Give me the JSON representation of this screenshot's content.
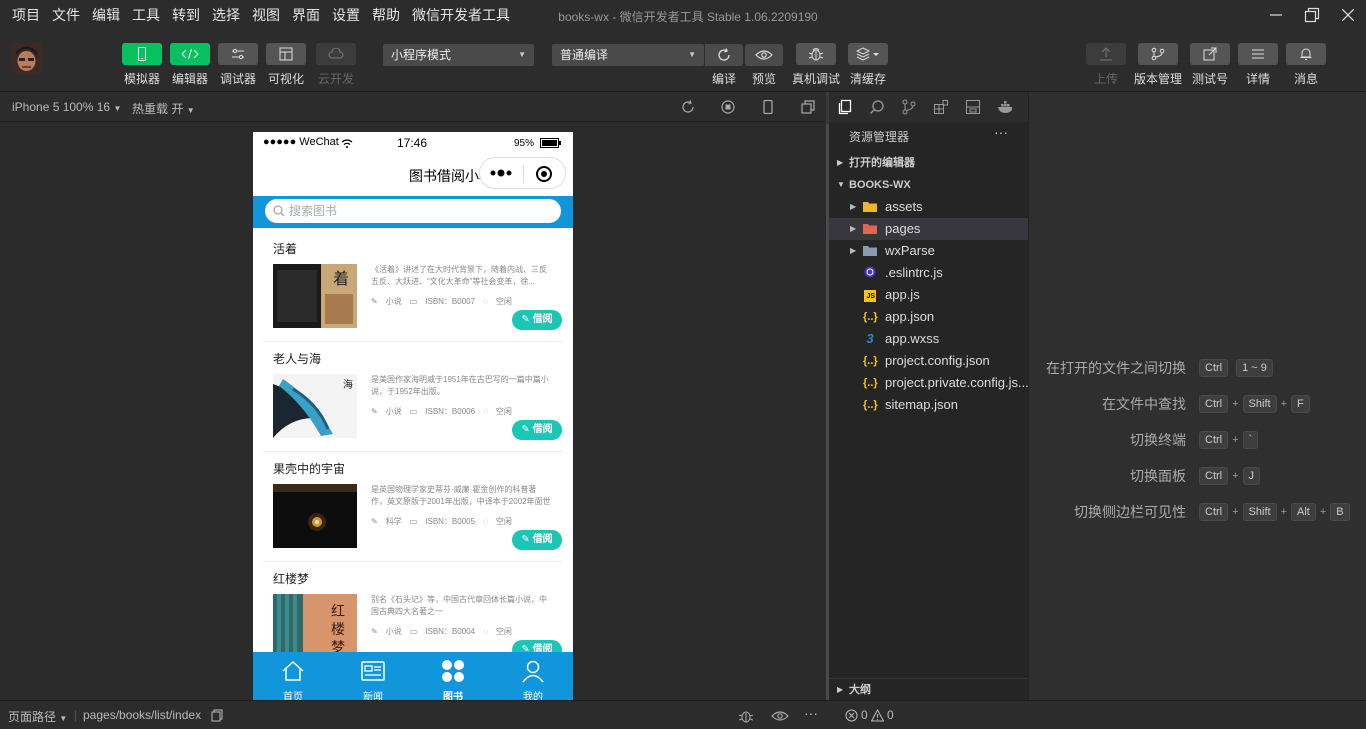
{
  "menu": [
    "项目",
    "文件",
    "编辑",
    "工具",
    "转到",
    "选择",
    "视图",
    "界面",
    "设置",
    "帮助",
    "微信开发者工具"
  ],
  "window_title": "books-wx - 微信开发者工具 Stable 1.06.2209190",
  "toolbar": {
    "simulator": "模拟器",
    "editor": "编辑器",
    "debugger": "调试器",
    "visual": "可视化",
    "cloud": "云开发",
    "mode_select": "小程序模式",
    "compile_select": "普通编译",
    "compile": "编译",
    "preview": "预览",
    "real_debug": "真机调试",
    "clear_cache": "清缓存",
    "upload": "上传",
    "version": "版本管理",
    "test_account": "测试号",
    "details": "详情",
    "messages": "消息"
  },
  "simbar": {
    "device": "iPhone 5 100% 16",
    "hot_reload": "热重载 开"
  },
  "phone": {
    "carrier": "●●●●● WeChat",
    "time": "17:46",
    "battery": "95%",
    "nav_title": "图书借阅小程序",
    "search_placeholder": "搜索图书",
    "books": [
      {
        "name": "活着",
        "desc": "《活着》讲述了在大时代背景下，随着内战、三反五反、大跃进、“文化大革命”等社会变革，徐...",
        "category": "小说",
        "isbn": "ISBN：B0007",
        "status": "空闲",
        "borrow": "借阅"
      },
      {
        "name": "老人与海",
        "desc": "是美国作家海明威于1951年在古巴写的一篇中篇小说，于1952年出版。",
        "category": "小说",
        "isbn": "ISBN：B0006",
        "status": "空闲",
        "borrow": "借阅"
      },
      {
        "name": "果壳中的宇宙",
        "desc": "是英国物理学家史蒂芬·威廉·霍金创作的科普著作，英文原版于2001年出版，中译本于2002年面世",
        "category": "科学",
        "isbn": "ISBN：B0005",
        "status": "空闲",
        "borrow": "借阅"
      },
      {
        "name": "红楼梦",
        "desc": "别名《石头记》等，中国古代章回体长篇小说，中国古典四大名著之一",
        "category": "小说",
        "isbn": "ISBN：B0004",
        "status": "空闲",
        "borrow": "借阅"
      }
    ],
    "tabs": [
      "首页",
      "新闻",
      "图书",
      "我的"
    ]
  },
  "explorer": {
    "header": "资源管理器",
    "more": "···",
    "open_editors": "打开的编辑器",
    "project": "BOOKS-WX",
    "outline": "大纲",
    "files": [
      {
        "name": "assets",
        "type": "folder"
      },
      {
        "name": "pages",
        "type": "folder"
      },
      {
        "name": "wxParse",
        "type": "folder"
      },
      {
        "name": ".eslintrc.js",
        "type": "eslint"
      },
      {
        "name": "app.js",
        "type": "js"
      },
      {
        "name": "app.json",
        "type": "json"
      },
      {
        "name": "app.wxss",
        "type": "wxss"
      },
      {
        "name": "project.config.json",
        "type": "json"
      },
      {
        "name": "project.private.config.js...",
        "type": "json"
      },
      {
        "name": "sitemap.json",
        "type": "json"
      }
    ]
  },
  "hints": [
    {
      "label": "在打开的文件之间切换",
      "keys": [
        "Ctrl",
        "1 ~ 9"
      ],
      "sep": " "
    },
    {
      "label": "在文件中查找",
      "keys": [
        "Ctrl",
        "Shift",
        "F"
      ],
      "sep": "+"
    },
    {
      "label": "切换终端",
      "keys": [
        "Ctrl",
        "`"
      ],
      "sep": "+"
    },
    {
      "label": "切换面板",
      "keys": [
        "Ctrl",
        "J"
      ],
      "sep": "+"
    },
    {
      "label": "切换侧边栏可见性",
      "keys": [
        "Ctrl",
        "Shift",
        "Alt",
        "B"
      ],
      "sep": "+"
    }
  ],
  "statusbar": {
    "page_path_label": "页面路径",
    "page_path": "pages/books/list/index",
    "errors": "0",
    "warnings": "0"
  },
  "colors": {
    "accent_green": "#07c160",
    "phone_blue": "#1296db",
    "borrow_teal": "#1ac6b4"
  }
}
